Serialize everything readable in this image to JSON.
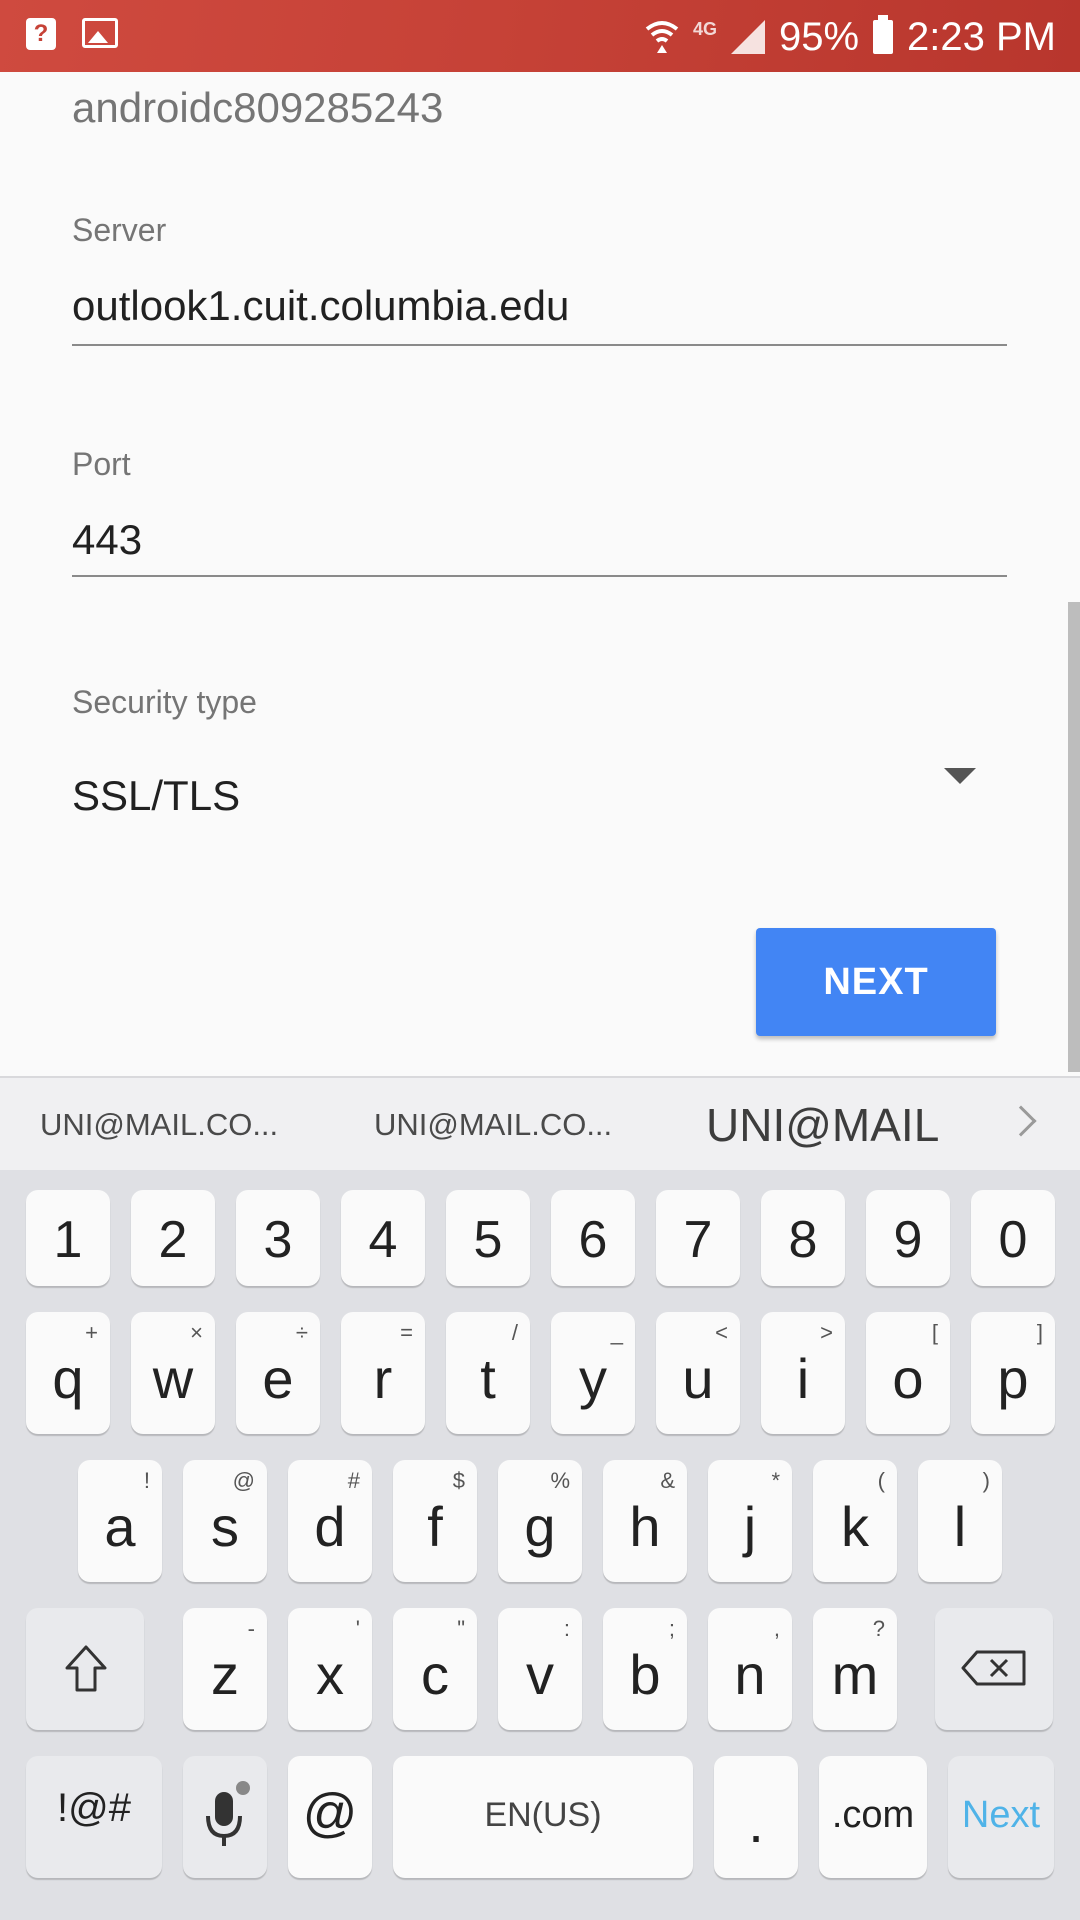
{
  "status_bar": {
    "help_label": "?",
    "network_type": "4G",
    "battery": "95%",
    "time": "2:23 PM"
  },
  "form": {
    "account_name": "androidc809285243",
    "server": {
      "label": "Server",
      "value": "outlook1.cuit.columbia.edu"
    },
    "port": {
      "label": "Port",
      "value": "443"
    },
    "security": {
      "label": "Security type",
      "value": "SSL/TLS"
    },
    "next_button": "NEXT",
    "accent_color": "#4285f4"
  },
  "suggestions": [
    "UNI@MAIL.CO...",
    "UNI@MAIL.CO...",
    "UNI@MAIL"
  ],
  "keyboard": {
    "numbers": [
      "1",
      "2",
      "3",
      "4",
      "5",
      "6",
      "7",
      "8",
      "9",
      "0"
    ],
    "row1": [
      {
        "k": "q",
        "h": "+"
      },
      {
        "k": "w",
        "h": "×"
      },
      {
        "k": "e",
        "h": "÷"
      },
      {
        "k": "r",
        "h": "="
      },
      {
        "k": "t",
        "h": "/"
      },
      {
        "k": "y",
        "h": "_"
      },
      {
        "k": "u",
        "h": "<"
      },
      {
        "k": "i",
        "h": ">"
      },
      {
        "k": "o",
        "h": "["
      },
      {
        "k": "p",
        "h": "]"
      }
    ],
    "row2": [
      {
        "k": "a",
        "h": "!"
      },
      {
        "k": "s",
        "h": "@"
      },
      {
        "k": "d",
        "h": "#"
      },
      {
        "k": "f",
        "h": "$"
      },
      {
        "k": "g",
        "h": "%"
      },
      {
        "k": "h",
        "h": "&"
      },
      {
        "k": "j",
        "h": "*"
      },
      {
        "k": "k",
        "h": "("
      },
      {
        "k": "l",
        "h": ")"
      }
    ],
    "row3": [
      {
        "k": "z",
        "h": "-"
      },
      {
        "k": "x",
        "h": "'"
      },
      {
        "k": "c",
        "h": "\""
      },
      {
        "k": "v",
        "h": ":"
      },
      {
        "k": "b",
        "h": ";"
      },
      {
        "k": "n",
        "h": ","
      },
      {
        "k": "m",
        "h": "?"
      }
    ],
    "symbols_key": "!@#",
    "at_key": "@",
    "space_label": "EN(US)",
    "period_key": ".",
    "dotcom_key": ".com",
    "action_key": "Next"
  }
}
